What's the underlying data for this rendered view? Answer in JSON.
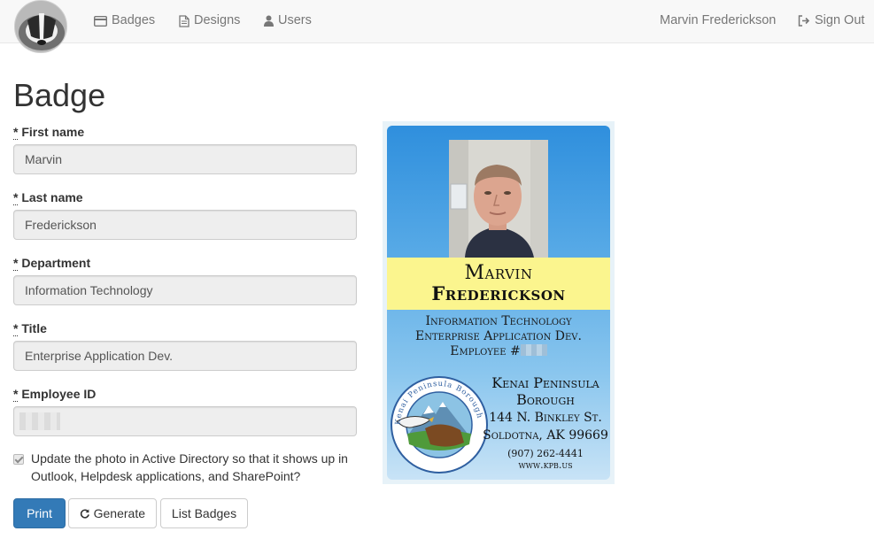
{
  "nav": {
    "badges": "Badges",
    "designs": "Designs",
    "users": "Users",
    "user_name": "Marvin Frederickson",
    "sign_out": "Sign Out"
  },
  "page": {
    "title": "Badge"
  },
  "form": {
    "required_marker": "*",
    "first_name": {
      "label": "First name",
      "value": "Marvin"
    },
    "last_name": {
      "label": "Last name",
      "value": "Frederickson"
    },
    "department": {
      "label": "Department",
      "value": "Information Technology"
    },
    "title": {
      "label": "Title",
      "value": "Enterprise Application Dev."
    },
    "employee_id": {
      "label": "Employee ID",
      "value": ""
    },
    "update_photo": {
      "checked": true,
      "label": "Update the photo in Active Directory so that it shows up in Outlook, Helpdesk applications, and SharePoint?"
    }
  },
  "buttons": {
    "print": "Print",
    "generate": "Generate",
    "list_badges": "List Badges"
  },
  "badge": {
    "first_name": "Marvin",
    "last_name": "Frederickson",
    "department": "Information Technology",
    "title": "Enterprise Application Dev.",
    "employee_prefix": "Employee #",
    "org_line1": "Kenai Peninsula",
    "org_line2": "Borough",
    "address1": "144 N. Binkley St.",
    "address2": "Soldotna, AK 99669",
    "phone": "(907) 262-4441",
    "website": "www.kpb.us",
    "seal_text": "Kenai Peninsula Borough"
  },
  "colors": {
    "primary": "#337ab7",
    "navbar_bg": "#f8f8f8",
    "name_band": "#fbf58e",
    "badge_blue": "#2f8fdd"
  },
  "icons": {
    "badges": "credit-card-icon",
    "designs": "file-icon",
    "users": "user-icon",
    "sign_out": "sign-out-icon",
    "generate": "refresh-icon"
  }
}
